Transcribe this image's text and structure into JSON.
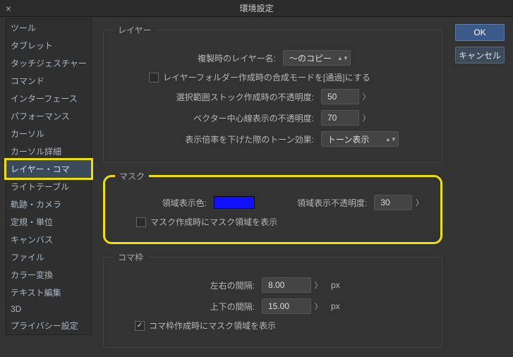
{
  "window": {
    "title": "環境設定"
  },
  "buttons": {
    "ok": "OK",
    "cancel": "キャンセル"
  },
  "sidebar": {
    "items": [
      {
        "label": "ツール"
      },
      {
        "label": "タブレット"
      },
      {
        "label": "タッチジェスチャー"
      },
      {
        "label": "コマンド"
      },
      {
        "label": "インターフェース"
      },
      {
        "label": "パフォーマンス"
      },
      {
        "label": "カーソル"
      },
      {
        "label": "カーソル詳細"
      },
      {
        "label": "レイヤー・コマ"
      },
      {
        "label": "ライトテーブル"
      },
      {
        "label": "軌跡・カメラ"
      },
      {
        "label": "定規・単位"
      },
      {
        "label": "キャンバス"
      },
      {
        "label": "ファイル"
      },
      {
        "label": "カラー変換"
      },
      {
        "label": "テキスト編集"
      },
      {
        "label": "3D"
      },
      {
        "label": "プライバシー設定"
      }
    ],
    "activeIndex": 8
  },
  "layerSection": {
    "legend": "レイヤー",
    "dupLabel": "複製時のレイヤー名:",
    "dupValue": "〜のコピー",
    "folderCheckbox": "レイヤーフォルダー作成時の合成モードを[通過]にする",
    "folderChecked": false,
    "selOpacityLabel": "選択範囲ストック作成時の不透明度:",
    "selOpacityValue": "50",
    "vecOpacityLabel": "ベクター中心線表示の不透明度:",
    "vecOpacityValue": "70",
    "toneLabel": "表示倍率を下げた際のトーン効果:",
    "toneValue": "トーン表示"
  },
  "maskSection": {
    "legend": "マスク",
    "colorLabel": "領域表示色:",
    "colorValue": "#1010ff",
    "opacityLabel": "領域表示不透明度:",
    "opacityValue": "30",
    "checkboxLabel": "マスク作成時にマスク領域を表示",
    "checked": false
  },
  "frameSection": {
    "legend": "コマ枠",
    "hgapLabel": "左右の間隔:",
    "hgapValue": "8.00",
    "vgapLabel": "上下の間隔:",
    "vgapValue": "15.00",
    "unit": "px",
    "checkboxLabel": "コマ枠作成時にマスク領域を表示",
    "checked": true
  }
}
